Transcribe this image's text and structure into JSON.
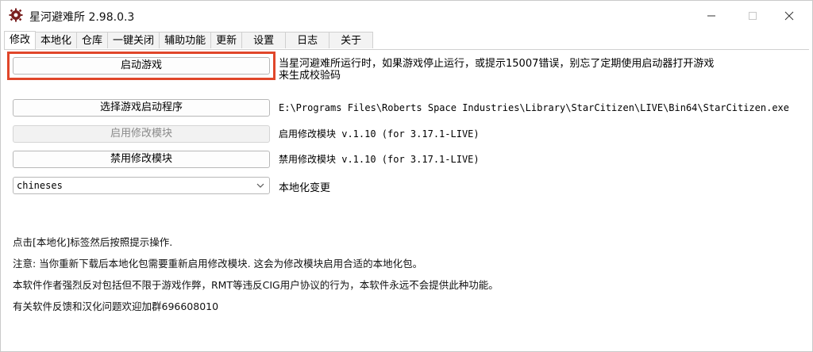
{
  "window": {
    "title": "星河避难所 2.98.0.3",
    "controls": {
      "minimize": "minimize-icon",
      "maximize": "maximize-icon",
      "close": "close-icon"
    }
  },
  "tabs": [
    {
      "label": "修改",
      "active": true
    },
    {
      "label": "本地化"
    },
    {
      "label": "仓库"
    },
    {
      "label": "一键关闭"
    },
    {
      "label": "辅助功能"
    },
    {
      "label": "更新"
    },
    {
      "label": "设置"
    },
    {
      "label": "日志"
    },
    {
      "label": "关于"
    }
  ],
  "modify": {
    "launch_button": "启动游戏",
    "launch_hint_line1": "当星河避难所运行时，如果游戏停止运行，或提示15007错误，别忘了定期使用启动器打开游戏",
    "launch_hint_line2": "来生成校验码",
    "select_exe_button": "选择游戏启动程序",
    "exe_path": "E:\\Programs Files\\Roberts Space Industries\\Library\\StarCitizen\\LIVE\\Bin64\\StarCitizen.exe",
    "enable_mod_button": "启用修改模块",
    "enable_mod_status": "启用修改模块 v.1.10 (for 3.17.1-LIVE)",
    "disable_mod_button": "禁用修改模块",
    "disable_mod_status": "禁用修改模块 v.1.10 (for 3.17.1-LIVE)",
    "localization_select_value": "chineses",
    "localization_label": "本地化变更"
  },
  "notes": [
    "点击[本地化]标签然后按照提示操作.",
    "注意: 当你重新下载后本地化包需要重新启用修改模块. 这会为修改模块启用合适的本地化包。",
    "本软件作者强烈反对包括但不限于游戏作弊，RMT等违反CIG用户协议的行为，本软件永远不会提供此种功能。",
    "有关软件反馈和汉化问题欢迎加群696608010"
  ],
  "colors": {
    "highlight": "#e0462a",
    "border": "#b8b8b8",
    "disabled_text": "#8a8a8a"
  }
}
